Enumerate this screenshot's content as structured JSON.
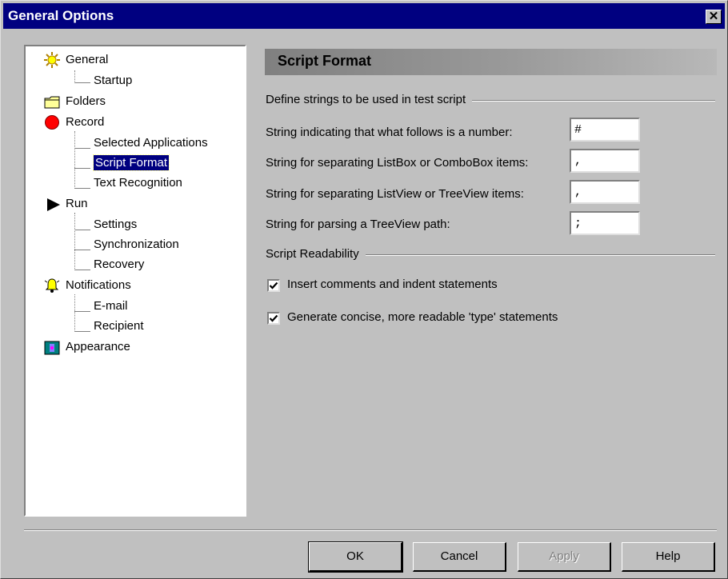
{
  "window": {
    "title": "General Options"
  },
  "tree": {
    "items": [
      {
        "label": "General",
        "icon": "sun-icon"
      },
      {
        "label": "Startup"
      },
      {
        "label": "Folders",
        "icon": "folder-icon"
      },
      {
        "label": "Record",
        "icon": "record-icon"
      },
      {
        "label": "Selected Applications"
      },
      {
        "label": "Script Format",
        "selected": true
      },
      {
        "label": "Text Recognition"
      },
      {
        "label": "Run",
        "icon": "play-icon"
      },
      {
        "label": "Settings"
      },
      {
        "label": "Synchronization"
      },
      {
        "label": "Recovery"
      },
      {
        "label": "Notifications",
        "icon": "bell-icon"
      },
      {
        "label": "E-mail"
      },
      {
        "label": "Recipient"
      },
      {
        "label": "Appearance",
        "icon": "appearance-icon"
      }
    ]
  },
  "panel": {
    "title": "Script Format",
    "section1": "Define strings to be used in test script",
    "fields": [
      {
        "label": "String indicating that what follows is a number:",
        "value": "#"
      },
      {
        "label": "String for separating ListBox or ComboBox items:",
        "value": ","
      },
      {
        "label": "String for separating ListView or TreeView items:",
        "value": ","
      },
      {
        "label": "String for parsing a TreeView path:",
        "value": ";"
      }
    ],
    "section2": "Script Readability",
    "checkboxes": [
      {
        "label": "Insert comments and indent statements",
        "checked": true
      },
      {
        "label": "Generate concise, more readable 'type' statements",
        "checked": true
      }
    ]
  },
  "buttons": {
    "ok": "OK",
    "cancel": "Cancel",
    "apply": "Apply",
    "help": "Help"
  }
}
